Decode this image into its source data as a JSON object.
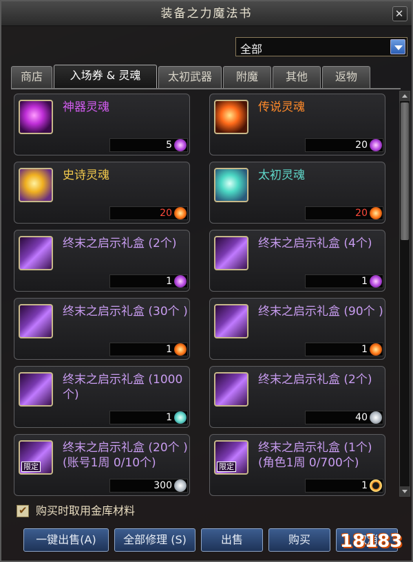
{
  "window": {
    "title": "装备之力魔法书"
  },
  "filter": {
    "selected": "全部"
  },
  "tabs": [
    {
      "label": "商店",
      "active": false
    },
    {
      "label": "入场券 & 灵魂",
      "active": true
    },
    {
      "label": "太初武器",
      "active": false
    },
    {
      "label": "附魔",
      "active": false
    },
    {
      "label": "其他",
      "active": false
    },
    {
      "label": "返物",
      "active": false
    }
  ],
  "items": [
    {
      "name": "神器灵魂",
      "price": "5",
      "color": "#d25cf0",
      "icon": "artifact-soul-icon",
      "coin": "purple-soul-coin"
    },
    {
      "name": "传说灵魂",
      "price": "20",
      "color": "#ff8a2a",
      "icon": "legendary-soul-icon",
      "coin": "purple-soul-coin"
    },
    {
      "name": "史诗灵魂",
      "price": "20",
      "price_red": true,
      "color": "#f2c94c",
      "icon": "epic-soul-icon",
      "coin": "orange-soul-coin"
    },
    {
      "name": "太初灵魂",
      "price": "20",
      "price_red": true,
      "color": "#5fd6c8",
      "icon": "primal-soul-icon",
      "coin": "orange-soul-coin"
    },
    {
      "name": "终末之启示礼盒 (2个)",
      "price": "1",
      "color": "#c89cf0",
      "icon": "gift-box-icon",
      "coin": "purple-soul-coin"
    },
    {
      "name": "终末之启示礼盒 (4个)",
      "price": "1",
      "color": "#c89cf0",
      "icon": "gift-box-icon",
      "coin": "purple-soul-coin"
    },
    {
      "name": "终末之启示礼盒 (30个 )",
      "price": "1",
      "color": "#c89cf0",
      "icon": "gift-box-icon",
      "coin": "orange-soul-coin"
    },
    {
      "name": "终末之启示礼盒 (90个 )",
      "price": "1",
      "color": "#c89cf0",
      "icon": "gift-box-icon",
      "coin": "orange-soul-coin"
    },
    {
      "name": "终末之启示礼盒 (1000 个)",
      "price": "1",
      "color": "#c89cf0",
      "icon": "gift-box-icon",
      "coin": "teal-soul-coin"
    },
    {
      "name": "终末之启示礼盒 (2个)",
      "price": "40",
      "color": "#c89cf0",
      "icon": "gift-box-icon",
      "coin": "silver-coin"
    },
    {
      "name": "终末之启示礼盒 (20个 )  (账号1周 0/10个)",
      "price": "300",
      "color": "#c89cf0",
      "icon": "gift-box-icon",
      "coin": "silver-coin",
      "limited": "限定"
    },
    {
      "name": "终末之启示礼盒 (1个)  (角色1周 0/700个)",
      "price": "1",
      "color": "#c89cf0",
      "icon": "gift-box-icon",
      "coin": "orange-ring-coin",
      "limited": "限定"
    }
  ],
  "footer": {
    "checkbox_label": "购买时取用金库材料",
    "checkbox_checked": true,
    "buttons": [
      "一键出售(A)",
      "全部修理 (S)",
      "出售",
      "购买",
      "取消"
    ]
  },
  "watermark": "18183"
}
